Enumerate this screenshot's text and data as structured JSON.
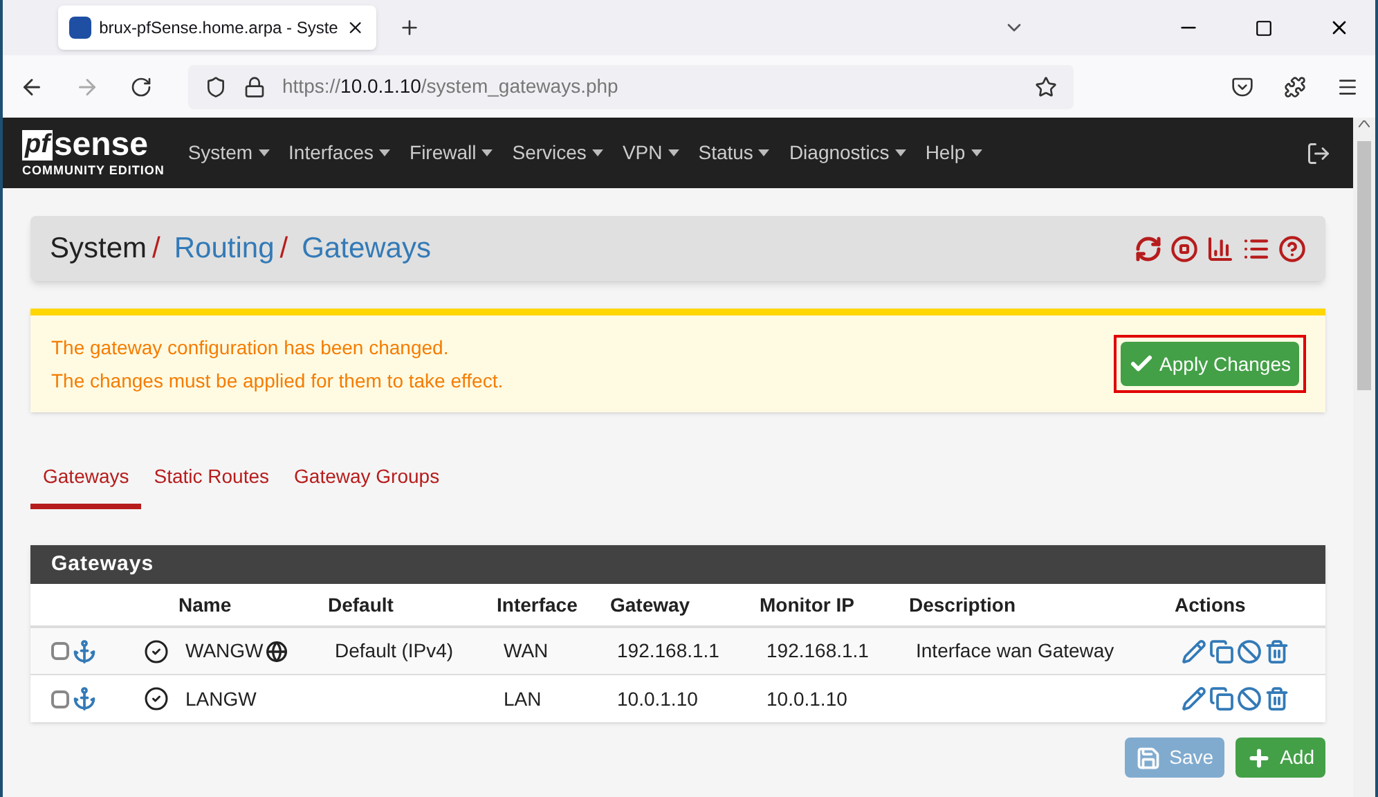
{
  "browser": {
    "tab_title": "brux-pfSense.home.arpa - Syste",
    "url_scheme": "https://",
    "url_host": "10.0.1.10",
    "url_path": "/system_gateways.php"
  },
  "navbar": {
    "logo_pf": "pf",
    "logo_sense": "sense",
    "logo_edition": "COMMUNITY EDITION",
    "menu": [
      "System",
      "Interfaces",
      "Firewall",
      "Services",
      "VPN",
      "Status",
      "Diagnostics",
      "Help"
    ]
  },
  "breadcrumb": [
    {
      "label": "System",
      "kind": "text"
    },
    {
      "label": "Routing",
      "kind": "link"
    },
    {
      "label": "Gateways",
      "kind": "link"
    }
  ],
  "breadcrumb_separator": "/",
  "alert": {
    "lines": [
      "The gateway configuration has been changed.",
      "The changes must be applied for them to take effect."
    ],
    "button": "Apply Changes",
    "button_highlighted": true
  },
  "tabs": [
    {
      "label": "Gateways",
      "selected": true
    },
    {
      "label": "Static Routes",
      "selected": false
    },
    {
      "label": "Gateway Groups",
      "selected": false
    }
  ],
  "table": {
    "title": "Gateways",
    "columns": [
      "Name",
      "Default",
      "Interface",
      "Gateway",
      "Monitor IP",
      "Description",
      "Actions"
    ],
    "rows": [
      {
        "checked": false,
        "name": "WANGW",
        "default_gateway": true,
        "default": "Default (IPv4)",
        "interface": "WAN",
        "gateway": "192.168.1.1",
        "monitor_ip": "192.168.1.1",
        "description": "Interface wan Gateway"
      },
      {
        "checked": false,
        "name": "LANGW",
        "default_gateway": false,
        "interface": "LAN",
        "gateway": "10.0.1.10",
        "monitor_ip": "10.0.1.10"
      }
    ]
  },
  "buttons": [
    {
      "label": "Save",
      "kind": "save",
      "disabled": true
    },
    {
      "label": "Add",
      "kind": "add",
      "disabled": false
    }
  ]
}
